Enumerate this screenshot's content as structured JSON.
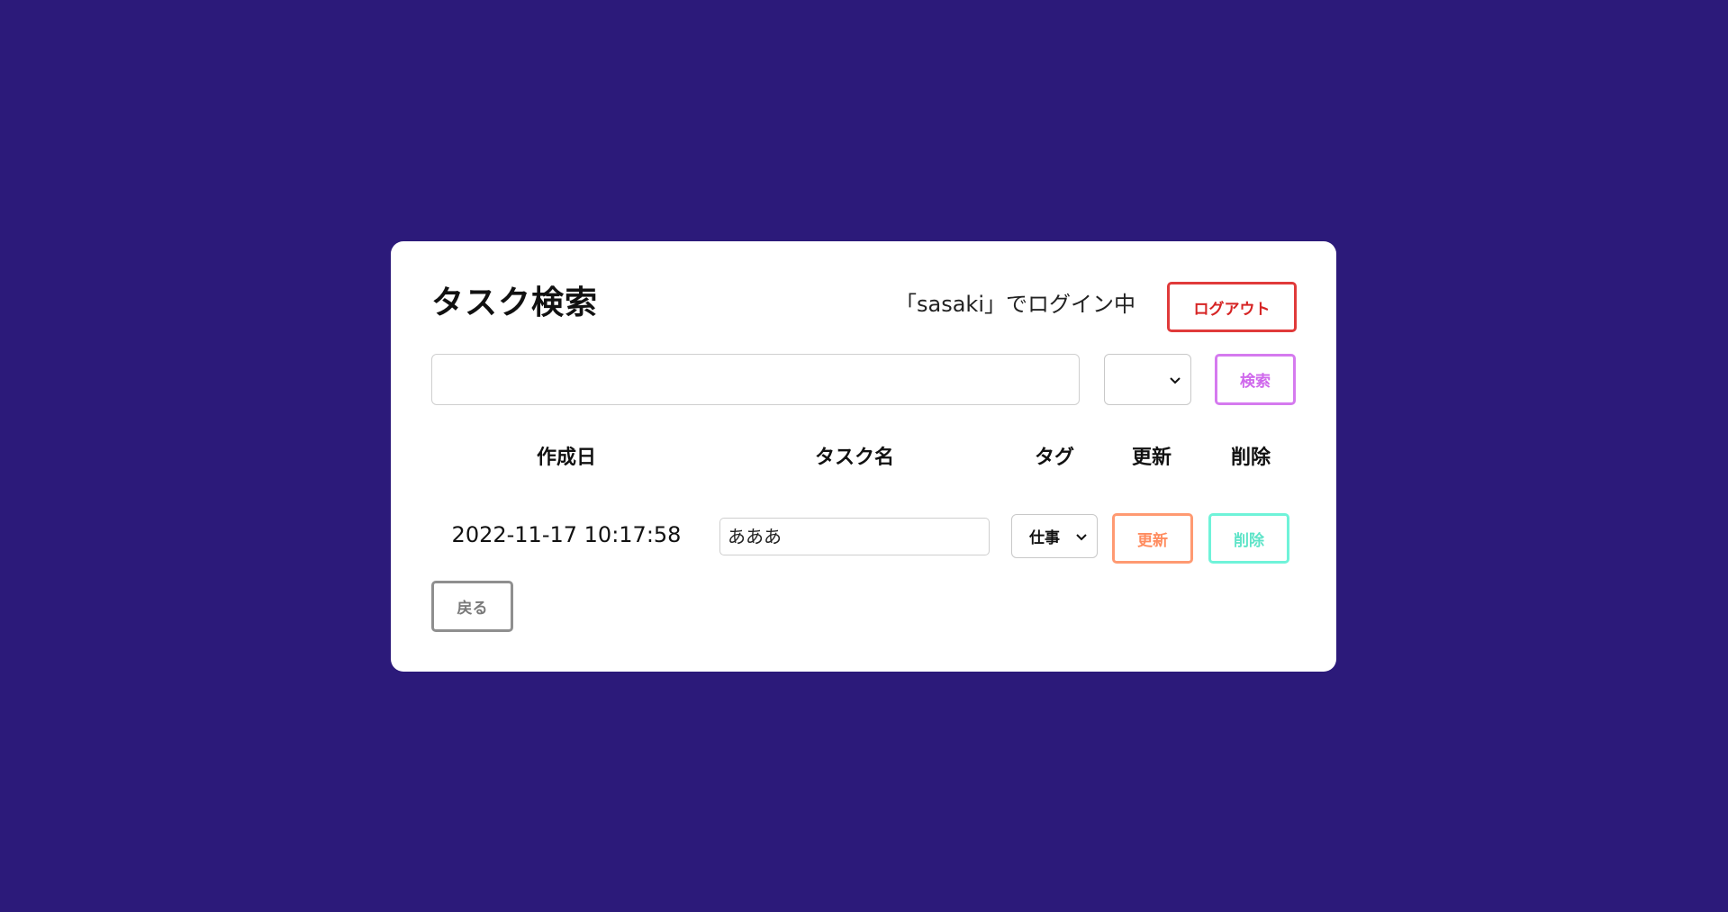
{
  "page": {
    "title": "タスク検索",
    "login_status": "「sasaki」でログイン中",
    "logout_label": "ログアウト"
  },
  "search": {
    "query_value": "",
    "tag_filter_value": "",
    "search_label": "検索"
  },
  "table": {
    "headers": {
      "date": "作成日",
      "name": "タスク名",
      "tag": "タグ",
      "update": "更新",
      "delete": "削除"
    },
    "rows": [
      {
        "date": "2022-11-17 10:17:58",
        "name": "あああ",
        "tag": "仕事",
        "update_label": "更新",
        "delete_label": "削除"
      }
    ]
  },
  "footer": {
    "back_label": "戻る"
  },
  "colors": {
    "background": "#2c1a7a",
    "logout": "#e03a3a",
    "search": "#d57aef",
    "update": "#ff9a72",
    "delete": "#6ff3d9",
    "back": "#8f8f8f"
  },
  "icons": {
    "select_arrow": "chevron-down-icon"
  }
}
